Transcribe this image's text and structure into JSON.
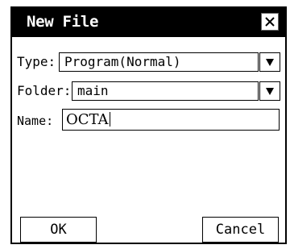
{
  "dialog": {
    "title": "New File",
    "close_icon": "close-x-icon"
  },
  "form": {
    "type_label": "Type:",
    "type_value": "Program(Normal)",
    "folder_label": "Folder:",
    "folder_value": "main",
    "name_label": "Name:",
    "name_value": "OCTA",
    "dropdown_icon": "triangle-down-icon"
  },
  "buttons": {
    "ok_label": "OK",
    "cancel_label": "Cancel"
  }
}
